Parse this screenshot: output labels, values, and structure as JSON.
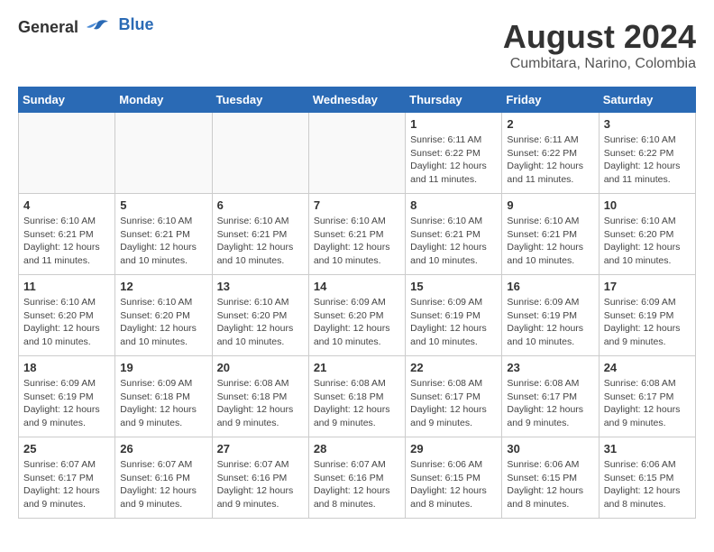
{
  "logo": {
    "general": "General",
    "blue": "Blue"
  },
  "header": {
    "title": "August 2024",
    "subtitle": "Cumbitara, Narino, Colombia"
  },
  "weekdays": [
    "Sunday",
    "Monday",
    "Tuesday",
    "Wednesday",
    "Thursday",
    "Friday",
    "Saturday"
  ],
  "weeks": [
    [
      {
        "day": "",
        "info": ""
      },
      {
        "day": "",
        "info": ""
      },
      {
        "day": "",
        "info": ""
      },
      {
        "day": "",
        "info": ""
      },
      {
        "day": "1",
        "info": "Sunrise: 6:11 AM\nSunset: 6:22 PM\nDaylight: 12 hours\nand 11 minutes."
      },
      {
        "day": "2",
        "info": "Sunrise: 6:11 AM\nSunset: 6:22 PM\nDaylight: 12 hours\nand 11 minutes."
      },
      {
        "day": "3",
        "info": "Sunrise: 6:10 AM\nSunset: 6:22 PM\nDaylight: 12 hours\nand 11 minutes."
      }
    ],
    [
      {
        "day": "4",
        "info": "Sunrise: 6:10 AM\nSunset: 6:21 PM\nDaylight: 12 hours\nand 11 minutes."
      },
      {
        "day": "5",
        "info": "Sunrise: 6:10 AM\nSunset: 6:21 PM\nDaylight: 12 hours\nand 10 minutes."
      },
      {
        "day": "6",
        "info": "Sunrise: 6:10 AM\nSunset: 6:21 PM\nDaylight: 12 hours\nand 10 minutes."
      },
      {
        "day": "7",
        "info": "Sunrise: 6:10 AM\nSunset: 6:21 PM\nDaylight: 12 hours\nand 10 minutes."
      },
      {
        "day": "8",
        "info": "Sunrise: 6:10 AM\nSunset: 6:21 PM\nDaylight: 12 hours\nand 10 minutes."
      },
      {
        "day": "9",
        "info": "Sunrise: 6:10 AM\nSunset: 6:21 PM\nDaylight: 12 hours\nand 10 minutes."
      },
      {
        "day": "10",
        "info": "Sunrise: 6:10 AM\nSunset: 6:20 PM\nDaylight: 12 hours\nand 10 minutes."
      }
    ],
    [
      {
        "day": "11",
        "info": "Sunrise: 6:10 AM\nSunset: 6:20 PM\nDaylight: 12 hours\nand 10 minutes."
      },
      {
        "day": "12",
        "info": "Sunrise: 6:10 AM\nSunset: 6:20 PM\nDaylight: 12 hours\nand 10 minutes."
      },
      {
        "day": "13",
        "info": "Sunrise: 6:10 AM\nSunset: 6:20 PM\nDaylight: 12 hours\nand 10 minutes."
      },
      {
        "day": "14",
        "info": "Sunrise: 6:09 AM\nSunset: 6:20 PM\nDaylight: 12 hours\nand 10 minutes."
      },
      {
        "day": "15",
        "info": "Sunrise: 6:09 AM\nSunset: 6:19 PM\nDaylight: 12 hours\nand 10 minutes."
      },
      {
        "day": "16",
        "info": "Sunrise: 6:09 AM\nSunset: 6:19 PM\nDaylight: 12 hours\nand 10 minutes."
      },
      {
        "day": "17",
        "info": "Sunrise: 6:09 AM\nSunset: 6:19 PM\nDaylight: 12 hours\nand 9 minutes."
      }
    ],
    [
      {
        "day": "18",
        "info": "Sunrise: 6:09 AM\nSunset: 6:19 PM\nDaylight: 12 hours\nand 9 minutes."
      },
      {
        "day": "19",
        "info": "Sunrise: 6:09 AM\nSunset: 6:18 PM\nDaylight: 12 hours\nand 9 minutes."
      },
      {
        "day": "20",
        "info": "Sunrise: 6:08 AM\nSunset: 6:18 PM\nDaylight: 12 hours\nand 9 minutes."
      },
      {
        "day": "21",
        "info": "Sunrise: 6:08 AM\nSunset: 6:18 PM\nDaylight: 12 hours\nand 9 minutes."
      },
      {
        "day": "22",
        "info": "Sunrise: 6:08 AM\nSunset: 6:17 PM\nDaylight: 12 hours\nand 9 minutes."
      },
      {
        "day": "23",
        "info": "Sunrise: 6:08 AM\nSunset: 6:17 PM\nDaylight: 12 hours\nand 9 minutes."
      },
      {
        "day": "24",
        "info": "Sunrise: 6:08 AM\nSunset: 6:17 PM\nDaylight: 12 hours\nand 9 minutes."
      }
    ],
    [
      {
        "day": "25",
        "info": "Sunrise: 6:07 AM\nSunset: 6:17 PM\nDaylight: 12 hours\nand 9 minutes."
      },
      {
        "day": "26",
        "info": "Sunrise: 6:07 AM\nSunset: 6:16 PM\nDaylight: 12 hours\nand 9 minutes."
      },
      {
        "day": "27",
        "info": "Sunrise: 6:07 AM\nSunset: 6:16 PM\nDaylight: 12 hours\nand 9 minutes."
      },
      {
        "day": "28",
        "info": "Sunrise: 6:07 AM\nSunset: 6:16 PM\nDaylight: 12 hours\nand 8 minutes."
      },
      {
        "day": "29",
        "info": "Sunrise: 6:06 AM\nSunset: 6:15 PM\nDaylight: 12 hours\nand 8 minutes."
      },
      {
        "day": "30",
        "info": "Sunrise: 6:06 AM\nSunset: 6:15 PM\nDaylight: 12 hours\nand 8 minutes."
      },
      {
        "day": "31",
        "info": "Sunrise: 6:06 AM\nSunset: 6:15 PM\nDaylight: 12 hours\nand 8 minutes."
      }
    ]
  ]
}
